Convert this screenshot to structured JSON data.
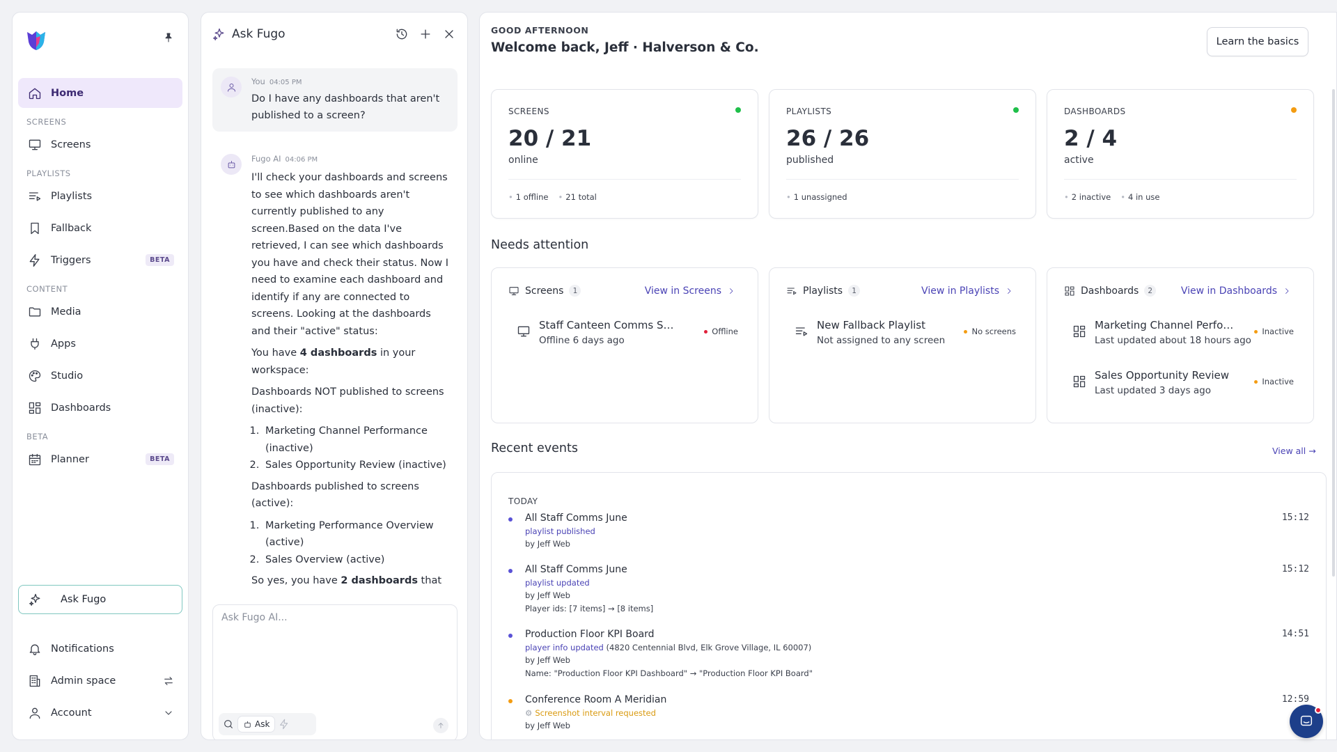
{
  "colors": {
    "accent": "#4a43b5",
    "active_bg": "#efe8fb",
    "online_dot": "#1fbf4a",
    "warn_dot": "#f39c12",
    "offline_dot": "#e0203a",
    "event_dot": "#5a52d6"
  },
  "sidebar": {
    "items": {
      "home": "Home",
      "screens_section": "SCREENS",
      "screens": "Screens",
      "playlists_section": "PLAYLISTS",
      "playlists": "Playlists",
      "fallback": "Fallback",
      "triggers": "Triggers",
      "triggers_badge": "BETA",
      "content_section": "CONTENT",
      "media": "Media",
      "apps": "Apps",
      "studio": "Studio",
      "dashboards": "Dashboards",
      "beta_section": "BETA",
      "planner": "Planner",
      "planner_badge": "BETA"
    },
    "ask_button": "Ask Fugo",
    "bottom": {
      "notifications": "Notifications",
      "admin_space": "Admin space",
      "account": "Account"
    }
  },
  "chat": {
    "title": "Ask Fugo",
    "user_message": {
      "author": "You",
      "time": "04:05 PM",
      "text": "Do I have any dashboards that aren't published to a screen?"
    },
    "ai_message": {
      "author": "Fugo AI",
      "time": "04:06 PM",
      "intro": "I'll check your dashboards and screens to see which dashboards aren't currently published to any screen.Based on the data I've retrieved, I can see which dashboards you have and check their status. Now I need to examine each dashboard and identify if any are connected to screens. Looking at the dashboards and their \"active\" status:",
      "count_prefix": "You have ",
      "count_bold": "4 dashboards",
      "count_suffix": " in your workspace:",
      "not_published_heading": "Dashboards NOT published to screens (inactive):",
      "not_published": [
        {
          "name": "Marketing Channel Performance",
          "status": " (inactive)"
        },
        {
          "name": "Sales Opportunity Review",
          "status": " (inactive)"
        }
      ],
      "published_heading": "Dashboards published to screens (active):",
      "published": [
        {
          "name": "Marketing Performance Overview",
          "status": " (active)"
        },
        {
          "name": "Sales Overview",
          "status": " (active)"
        }
      ],
      "closing_prefix": "So yes, you have ",
      "closing_bold": "2 dashboards",
      "closing_suffix": " that"
    },
    "input_placeholder": "Ask Fugo AI...",
    "ask_tool": "Ask"
  },
  "header": {
    "greeting": "GOOD AFTERNOON",
    "welcome": "Welcome back, Jeff · Halverson & Co.",
    "learn_button": "Learn the basics"
  },
  "stats": [
    {
      "label": "SCREENS",
      "value": "20 / 21",
      "sub": "online",
      "foot": [
        "1 offline",
        "21 total"
      ],
      "dot": "#1fbf4a"
    },
    {
      "label": "PLAYLISTS",
      "value": "26 / 26",
      "sub": "published",
      "foot": [
        "1 unassigned"
      ],
      "dot": "#1fbf4a"
    },
    {
      "label": "DASHBOARDS",
      "value": "2 / 4",
      "sub": "active",
      "foot": [
        "2 inactive",
        "4 in use"
      ],
      "dot": "#f39c12"
    }
  ],
  "needs_attention": {
    "title": "Needs attention",
    "cards": [
      {
        "label": "Screens",
        "count": "1",
        "link": "View in Screens",
        "items": [
          {
            "name": "Staff Canteen Comms Screen",
            "sub": "Offline 6 days ago",
            "status": "Offline",
            "dot": "#e0203a"
          }
        ]
      },
      {
        "label": "Playlists",
        "count": "1",
        "link": "View in Playlists",
        "items": [
          {
            "name": "New Fallback Playlist",
            "sub": "Not assigned to any screen",
            "status": "No screens",
            "dot": "#f39c12"
          }
        ]
      },
      {
        "label": "Dashboards",
        "count": "2",
        "link": "View in Dashboards",
        "items": [
          {
            "name": "Marketing Channel Perfor...",
            "sub": "Last updated about 18 hours ago",
            "status": "Inactive",
            "dot": "#f39c12"
          },
          {
            "name": "Sales Opportunity Review",
            "sub": "Last updated 3 days ago",
            "status": "Inactive",
            "dot": "#f39c12"
          }
        ]
      }
    ]
  },
  "recent_events": {
    "title": "Recent events",
    "view_all": "View all →",
    "group": "TODAY",
    "events": [
      {
        "title": "All Staff Comms June",
        "time": "15:12",
        "action": "playlist published",
        "by": "by Jeff Web",
        "dot": "#5a52d6"
      },
      {
        "title": "All Staff Comms June",
        "time": "15:12",
        "action": "playlist updated",
        "by": "by Jeff Web",
        "detail": "Player ids: [7 items] → [8 items]",
        "dot": "#5a52d6"
      },
      {
        "title": "Production Floor KPI Board",
        "time": "14:51",
        "action": "player info updated",
        "action_extra": " (4820 Centennial Blvd, Elk Grove Village, IL 60007)",
        "by": "by Jeff Web",
        "detail": "Name: \"Production Floor KPI Dashboard\" → \"Production Floor KPI Board\"",
        "dot": "#5a52d6"
      },
      {
        "title": "Conference Room A Meridian",
        "time": "12:59",
        "action": "Screenshot interval requested",
        "by": "by Jeff Web",
        "dot": "#f39c12"
      }
    ]
  }
}
